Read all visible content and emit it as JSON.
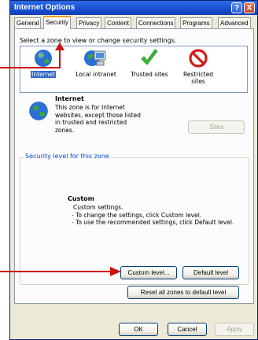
{
  "window": {
    "title": "Internet Options"
  },
  "titlebar": {
    "help_glyph": "?",
    "close_glyph": "X"
  },
  "tabs": [
    {
      "label": "General"
    },
    {
      "label": "Security"
    },
    {
      "label": "Privacy"
    },
    {
      "label": "Content"
    },
    {
      "label": "Connections"
    },
    {
      "label": "Programs"
    },
    {
      "label": "Advanced"
    }
  ],
  "security": {
    "zones_prompt": "Select a zone to view or change security settings.",
    "zones": [
      {
        "label": "Internet",
        "icon": "globe-icon"
      },
      {
        "label": "Local intranet",
        "icon": "intranet-computer-icon"
      },
      {
        "label": "Trusted sites",
        "icon": "checkmark-icon"
      },
      {
        "label": "Restricted sites",
        "icon": "restricted-icon"
      }
    ],
    "selected_zone": {
      "title": "Internet",
      "description": "This zone is for Internet websites, except those listed in trusted and restricted zones."
    },
    "sites_button": "Sites",
    "level_group_label": "Security level for this zone",
    "level": {
      "title": "Custom",
      "lines": [
        "Custom settings.",
        "- To change the settings, click Custom level.",
        "- To use the recommended settings, click Default level."
      ]
    },
    "custom_level_button": "Custom level...",
    "default_level_button": "Default level",
    "reset_button": "Reset all zones to default level"
  },
  "footer": {
    "ok": "OK",
    "cancel": "Cancel",
    "apply": "Apply"
  },
  "colors": {
    "title_bar": "#1a4fcf",
    "annotation_arrow": "#cc1111",
    "tab_highlight": "#f0a020",
    "selection": "#316ac5"
  }
}
